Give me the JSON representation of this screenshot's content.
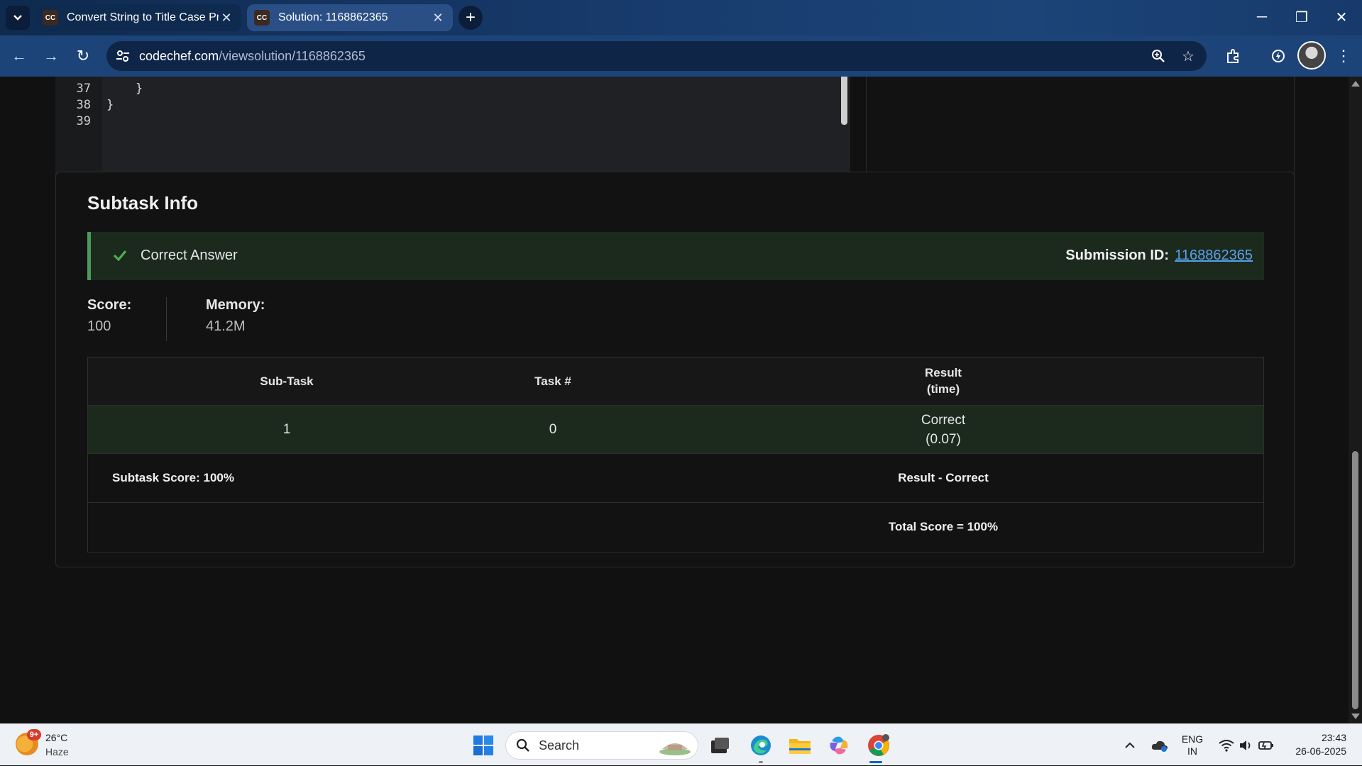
{
  "browser": {
    "tabs": [
      {
        "title": "Convert String to Title Case Practice",
        "favicon": "CC",
        "active": false
      },
      {
        "title": "Solution: 1168862365",
        "favicon": "CC",
        "active": true
      }
    ],
    "url_host": "codechef.com",
    "url_path": "/viewsolution/1168862365"
  },
  "code": {
    "lines": [
      {
        "num": "37",
        "text": "    }"
      },
      {
        "num": "38",
        "text": "}"
      },
      {
        "num": "39",
        "text": ""
      }
    ]
  },
  "subtask": {
    "heading": "Subtask Info",
    "verdict": "Correct Answer",
    "submission_label": "Submission ID:",
    "submission_id": "1168862365",
    "score_label": "Score:",
    "score_value": "100",
    "memory_label": "Memory:",
    "memory_value": "41.2M",
    "table": {
      "headers": [
        "Sub-Task",
        "Task #",
        "Result",
        "(time)"
      ],
      "rows": [
        {
          "subtask": "1",
          "task": "0",
          "result": "Correct",
          "time": "(0.07)"
        }
      ],
      "subtask_score": "Subtask Score: 100%",
      "result_summary": "Result - Correct",
      "total_score": "Total Score = 100%"
    }
  },
  "taskbar": {
    "weather_badge": "9+",
    "temperature": "26°C",
    "condition": "Haze",
    "search_placeholder": "Search",
    "language": "ENG",
    "region": "IN",
    "time": "23:43",
    "date": "26-06-2025"
  },
  "colors": {
    "accent_green": "#4a9b5a",
    "link_blue": "#5aa0ea",
    "page_bg": "#121212",
    "chrome_blue": "#1c4478"
  }
}
